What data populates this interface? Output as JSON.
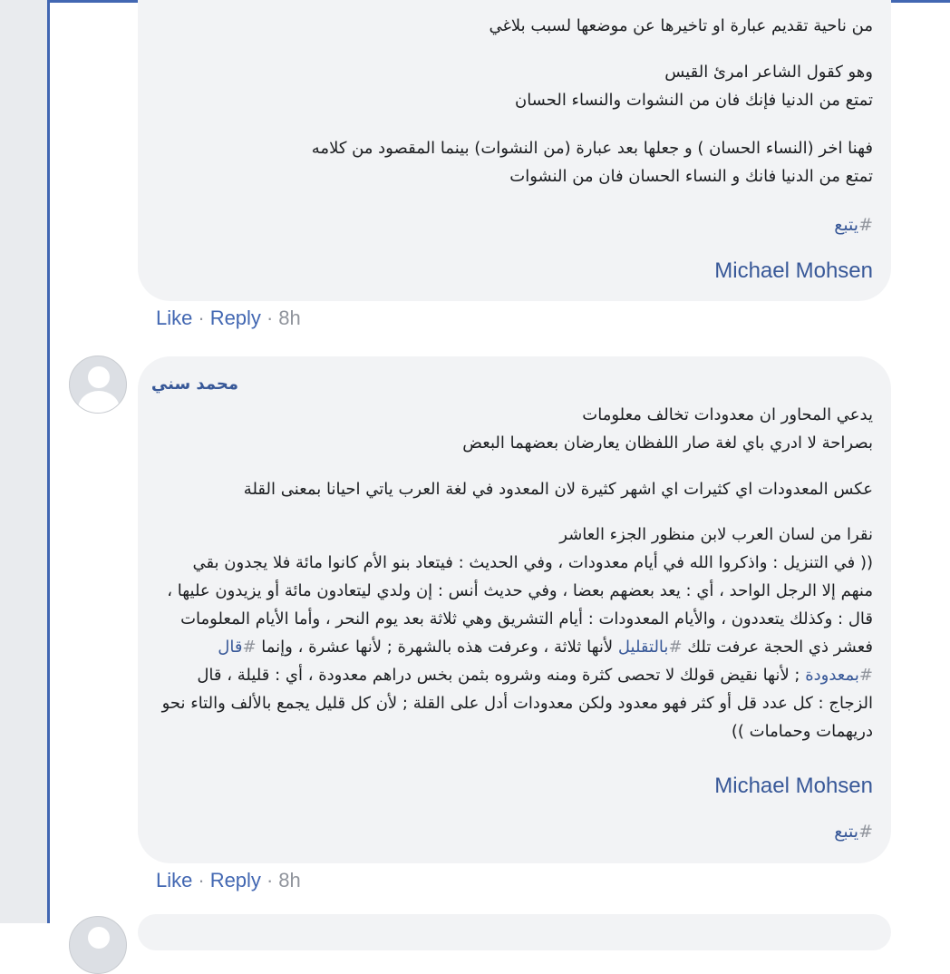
{
  "colors": {
    "link": "#385898",
    "action_link": "#4267b2",
    "meta": "#90949c",
    "bubble_bg": "#f2f3f5",
    "frame_accent": "#4267b2"
  },
  "comment1": {
    "paragraph1": "من ناحية تقديم عبارة او تاخيرها عن موضعها لسبب بلاغي",
    "paragraph2": "وهو كقول الشاعر امرئ القيس\nتمتع من الدنيا فإنك فان من النشوات والنساء الحسان",
    "paragraph3": "فهنا اخر (النساء الحسان ) و جعلها بعد عبارة (من النشوات) بينما المقصود من كلامه\nتمتع من الدنيا فانك و النساء الحسان فان من النشوات",
    "hashtag": "يتبع",
    "mention": "Michael Mohsen"
  },
  "actions1": {
    "like": "Like",
    "reply": "Reply",
    "time": "8h"
  },
  "comment2": {
    "author": "محمد سني",
    "paragraph1": "يدعي المحاور ان معدودات تخالف معلومات\nبصراحة لا ادري باي لغة صار اللفظان يعارضان بعضهما البعض",
    "paragraph2": "عكس المعدودات اي كثيرات اي اشهر كثيرة لان المعدود في لغة العرب ياتي احيانا بمعنى القلة",
    "paragraph3_intro": "نقرا من لسان العرب لابن منظور الجزء العاشر",
    "quote_part1": "(( في التنزيل : واذكروا الله في أيام معدودات ، وفي الحديث : فيتعاد بنو الأم كانوا مائة فلا يجدون بقي منهم إلا الرجل الواحد ، أي : يعد بعضهم بعضا ، وفي حديث أنس : إن ولدي ليتعادون مائة أو يزيدون عليها ، قال : وكذلك يتعددون ، والأيام المعدودات : أيام التشريق وهي ثلاثة بعد يوم النحر ، وأما الأيام المعلومات فعشر ذي الحجة عرفت تلك ",
    "tag_bitaqlil": "بالتقليل",
    "quote_part2": " لأنها ثلاثة ، وعرفت هذه بالشهرة ; لأنها عشرة ، وإنما ",
    "tag_qal": "قال",
    "tag_bimadooda": "بمعدودة",
    "quote_part3": " ; لأنها نقيض قولك لا تحصى كثرة ومنه وشروه بثمن بخس دراهم معدودة ، أي : قليلة ، قال الزجاج : كل عدد قل أو كثر فهو معدود ولكن معدودات أدل على القلة ; لأن كل قليل يجمع بالألف والتاء نحو دريهمات وحمامات ))",
    "mention": "Michael Mohsen",
    "hashtag": "يتبع"
  },
  "actions2": {
    "like": "Like",
    "reply": "Reply",
    "time": "8h"
  },
  "icons": {
    "avatar": "default-user-avatar-icon"
  }
}
